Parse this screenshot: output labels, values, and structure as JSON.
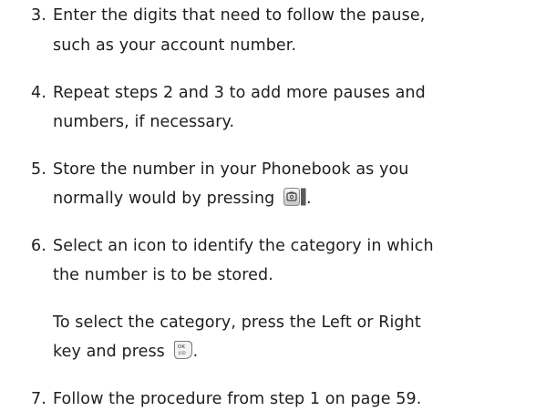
{
  "steps": [
    {
      "number": "3.",
      "lines": [
        "Enter the digits that need to follow the pause,",
        "such as your account number."
      ]
    },
    {
      "number": "4.",
      "lines": [
        "Repeat steps 2 and 3 to add more pauses and",
        "numbers, if necessary."
      ]
    },
    {
      "number": "5.",
      "lines": [
        "Store the number in your Phonebook as you",
        "normally would by pressing"
      ],
      "after_icon": ".",
      "icon": "phone-send-key-icon"
    },
    {
      "number": "6.",
      "lines": [
        "Select an icon to identify the category in which",
        "the number is to be stored."
      ],
      "sub_lines": [
        "To select the category, press the Left or Right",
        "key and press"
      ],
      "after_icon": ".",
      "icon": "ok-key-icon"
    },
    {
      "number": "7.",
      "lines": [
        "Follow the procedure from step 1 on page 59."
      ]
    }
  ],
  "ok_key_label_top": "OK",
  "ok_key_label_bottom": "i/⊙"
}
